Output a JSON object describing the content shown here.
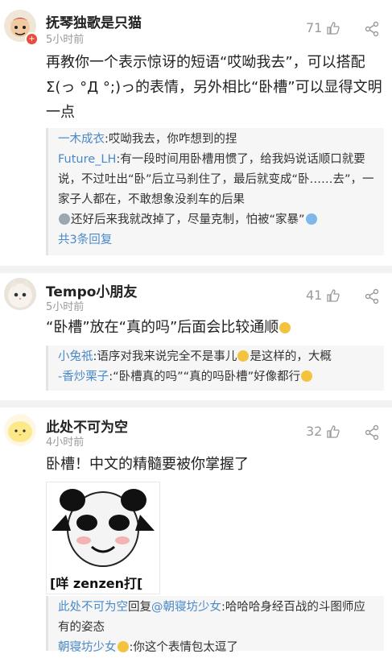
{
  "comments": [
    {
      "username": "抚琴独歌是只猫",
      "time": "5小时前",
      "likes": "71",
      "content": "再教你一个表示惊讶的短语“哎呦我去”，可以搭配Σ(っ °Д °;)っ的表情，另外相比“卧槽”可以显得文明一点",
      "replies": [
        {
          "name": "一木成衣",
          "text": ":哎呦我去，你咋想到的捏"
        },
        {
          "name": "Future_LH",
          "text": ":有一段时间用卧槽用惯了，给我妈说话顺口就要说，不过吐出“卧”后立马刹住了，最后就变成“卧……去”，一家子人都在，不敢想象没刹车的后果",
          "text2": "还好后来我就改掉了，尽量克制，怕被“家暴”"
        }
      ],
      "more": "共3条回复"
    },
    {
      "username": "Tempo小朋友",
      "time": "5小时前",
      "likes": "41",
      "content": "“卧槽”放在“真的吗”后面会比较通顺",
      "replies": [
        {
          "name": "小兔祇",
          "text": ":语序对我来说完全不是事儿",
          "text2": "是这样的，大概"
        },
        {
          "name": "-香炒栗子",
          "text": ":“卧槽真的吗”“真的吗卧槽”好像都行"
        }
      ]
    },
    {
      "username": "此处不可为空",
      "time": "4小时前",
      "likes": "32",
      "content": "卧槽！中文的精髓要被你掌握了",
      "meme_caption": "[咩 zenzen打[",
      "replies": [
        {
          "name": "此处不可为空",
          "reply_word": "回复",
          "target": "@朝寝坊少女",
          "text": ":哈哈哈身经百战的斗图师应有的姿态"
        },
        {
          "name": "朝寝坊少女",
          "text": ":你这个表情包太逗了"
        }
      ]
    }
  ],
  "colors": {
    "link": "#4a89c8",
    "meta": "#9a9a9a",
    "reply_bg": "#f6f6f6"
  },
  "icons": [
    "thumb-up-icon",
    "share-icon",
    "vip-badge-icon"
  ]
}
